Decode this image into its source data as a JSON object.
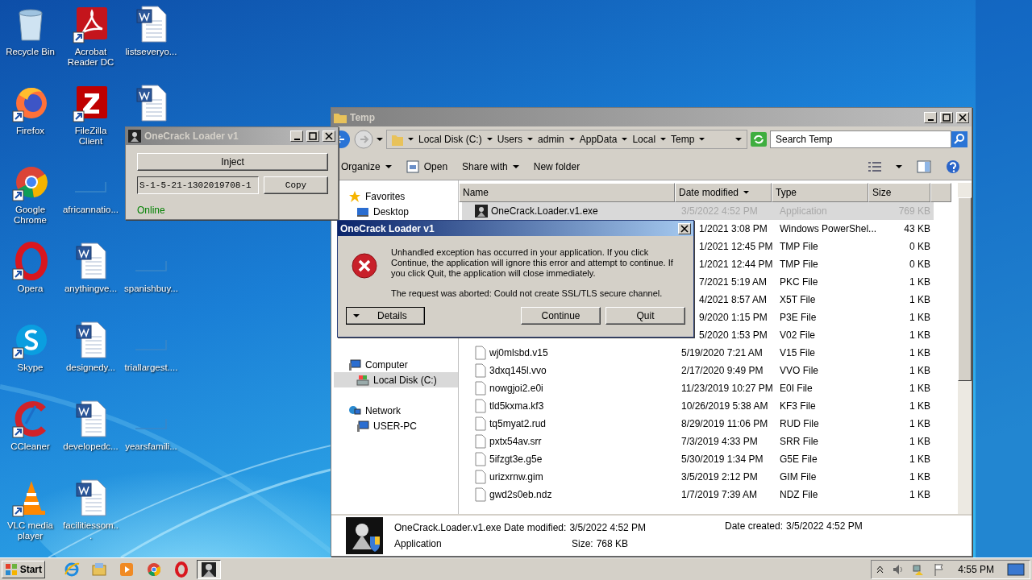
{
  "desktop": {
    "columns": [
      [
        {
          "kind": "recycle",
          "label": "Recycle Bin"
        },
        {
          "kind": "firefox",
          "label": "Firefox"
        },
        {
          "kind": "chrome",
          "label": "Google Chrome"
        },
        {
          "kind": "opera",
          "label": "Opera"
        },
        {
          "kind": "skype",
          "label": "Skype"
        },
        {
          "kind": "ccleaner",
          "label": "CCleaner"
        },
        {
          "kind": "vlc",
          "label": "VLC media player"
        }
      ],
      [
        {
          "kind": "acrobat",
          "label": "Acrobat Reader DC"
        },
        {
          "kind": "filezilla",
          "label": "FileZilla Client"
        },
        {
          "kind": "blank",
          "label": "africannatio..."
        },
        {
          "kind": "word",
          "label": "anythingve..."
        },
        {
          "kind": "word",
          "label": "designedy..."
        },
        {
          "kind": "word",
          "label": "developedc..."
        },
        {
          "kind": "word",
          "label": "facilitiessom..."
        }
      ],
      [
        {
          "kind": "word",
          "label": "listseveryo..."
        },
        {
          "kind": "word"
        },
        {
          "kind": "none"
        },
        {
          "kind": "blank",
          "label": "spanishbuy..."
        },
        {
          "kind": "blank",
          "label": "triallargest...."
        },
        {
          "kind": "blank",
          "label": "yearsfamili..."
        }
      ]
    ]
  },
  "loader_window": {
    "title": "OneCrack Loader v1",
    "active": false,
    "inject_button": "Inject",
    "sid_field": "S-1-5-21-1302019708-1",
    "copy_button": "Copy",
    "status": "Online"
  },
  "explorer": {
    "title": "Temp",
    "active": false,
    "address": [
      "Local Disk (C:)",
      "Users",
      "admin",
      "AppData",
      "Local",
      "Temp"
    ],
    "search": {
      "placeholder": "Search Temp"
    },
    "toolbar": [
      {
        "label": "Organize",
        "dropdown": true,
        "icon": false
      },
      {
        "label": "Open",
        "dropdown": false,
        "icon": true
      },
      {
        "label": "Share with",
        "dropdown": true,
        "icon": false
      },
      {
        "label": "New folder",
        "dropdown": false,
        "icon": false
      }
    ],
    "nav": [
      {
        "label": "Favorites",
        "kind": "favorites",
        "selected": false,
        "children": [
          {
            "label": "Desktop",
            "kind": "desktop",
            "selected": false
          }
        ]
      },
      {
        "label": "Computer",
        "kind": "computer",
        "selected": false,
        "children": [
          {
            "label": "Local Disk (C:)",
            "kind": "disk",
            "selected": true
          }
        ]
      },
      {
        "label": "Network",
        "kind": "network",
        "selected": false,
        "children": [
          {
            "label": "USER-PC",
            "kind": "computer",
            "selected": false
          }
        ]
      }
    ],
    "columns": [
      {
        "label": "Name",
        "sorted": false
      },
      {
        "label": "Date modified",
        "sorted": true
      },
      {
        "label": "Type",
        "sorted": false
      },
      {
        "label": "Size",
        "sorted": false
      }
    ],
    "rows": [
      {
        "kind": "app",
        "name": "OneCrack.Loader.v1.exe",
        "date": "3/5/2022 4:52 PM",
        "type": "Application",
        "size": "769 KB",
        "selected": true
      },
      {
        "kind": "covered",
        "date": "1/2021 3:08 PM",
        "type": "Windows PowerShel...",
        "size": "43 KB",
        "selected": false
      },
      {
        "kind": "covered",
        "date": "1/2021 12:45 PM",
        "type": "TMP File",
        "size": "0 KB",
        "selected": false
      },
      {
        "kind": "covered",
        "date": "1/2021 12:44 PM",
        "type": "TMP File",
        "size": "0 KB",
        "selected": false
      },
      {
        "kind": "covered",
        "date": "7/2021 5:19 AM",
        "type": "PKC File",
        "size": "1 KB",
        "selected": false
      },
      {
        "kind": "covered",
        "date": "4/2021 8:57 AM",
        "type": "X5T File",
        "size": "1 KB",
        "selected": false
      },
      {
        "kind": "covered",
        "date": "9/2020 1:15 PM",
        "type": "P3E File",
        "size": "1 KB",
        "selected": false
      },
      {
        "kind": "covered",
        "date": "5/2020 1:53 PM",
        "type": "V02 File",
        "size": "1 KB",
        "selected": false
      },
      {
        "kind": "file",
        "name": "wj0mlsbd.v15",
        "date": "5/19/2020 7:21 AM",
        "type": "V15 File",
        "size": "1 KB",
        "selected": false
      },
      {
        "kind": "file",
        "name": "3dxq145l.vvo",
        "date": "2/17/2020 9:49 PM",
        "type": "VVO File",
        "size": "1 KB",
        "selected": false
      },
      {
        "kind": "file",
        "name": "nowgjoi2.e0i",
        "date": "11/23/2019 10:27 PM",
        "type": "E0I File",
        "size": "1 KB",
        "selected": false
      },
      {
        "kind": "file",
        "name": "tld5kxma.kf3",
        "date": "10/26/2019 5:38 AM",
        "type": "KF3 File",
        "size": "1 KB",
        "selected": false
      },
      {
        "kind": "file",
        "name": "tq5myat2.rud",
        "date": "8/29/2019 11:06 PM",
        "type": "RUD File",
        "size": "1 KB",
        "selected": false
      },
      {
        "kind": "file",
        "name": "pxtx54av.srr",
        "date": "7/3/2019 4:33 PM",
        "type": "SRR File",
        "size": "1 KB",
        "selected": false
      },
      {
        "kind": "file",
        "name": "5ifzgt3e.g5e",
        "date": "5/30/2019 1:34 PM",
        "type": "G5E File",
        "size": "1 KB",
        "selected": false
      },
      {
        "kind": "file",
        "name": "urizxrnw.gim",
        "date": "3/5/2019 2:12 PM",
        "type": "GIM File",
        "size": "1 KB",
        "selected": false
      },
      {
        "kind": "file",
        "name": "gwd2s0eb.ndz",
        "date": "1/7/2019 7:39 AM",
        "type": "NDZ File",
        "size": "1 KB",
        "selected": false
      }
    ],
    "details": {
      "name": "OneCrack.Loader.v1.exe",
      "type": "Application",
      "modified_label": "Date modified:",
      "modified": "3/5/2022 4:52 PM",
      "size_label": "Size:",
      "size": "768 KB",
      "created_label": "Date created:",
      "created": "3/5/2022 4:52 PM"
    }
  },
  "error_dialog": {
    "title": "OneCrack Loader v1",
    "active": true,
    "message": "Unhandled exception has occurred in your application. If you click Continue, the application will ignore this error and attempt to continue. If you click Quit, the application will close immediately.",
    "detail": "The request was aborted: Could not create SSL/TLS secure channel.",
    "details_button": "Details",
    "continue_button": "Continue",
    "quit_button": "Quit"
  },
  "taskbar": {
    "start": "Start",
    "apps": [
      {
        "kind": "ie",
        "active": false
      },
      {
        "kind": "explorer",
        "active": false
      },
      {
        "kind": "media",
        "active": false
      },
      {
        "kind": "chrome",
        "active": false
      },
      {
        "kind": "opera",
        "active": false
      },
      {
        "kind": "loader",
        "active": true
      }
    ],
    "clock": "4:55 PM"
  }
}
